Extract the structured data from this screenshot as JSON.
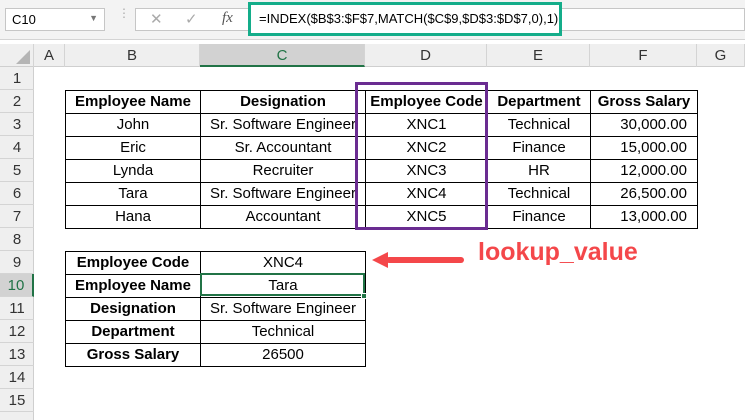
{
  "name_box": "C10",
  "formula": "=INDEX($B$3:$F$7,MATCH($C$9,$D$3:$D$7,0),1)",
  "columns": [
    "A",
    "B",
    "C",
    "D",
    "E",
    "F",
    "G"
  ],
  "rows": [
    "1",
    "2",
    "3",
    "4",
    "5",
    "6",
    "7",
    "8",
    "9",
    "10",
    "11",
    "12",
    "13",
    "14",
    "15"
  ],
  "table": {
    "headers": [
      "Employee Name",
      "Designation",
      "Employee Code",
      "Department",
      "Gross Salary"
    ],
    "rows": [
      [
        "John",
        "Sr. Software Engineer",
        "XNC1",
        "Technical",
        "30,000.00"
      ],
      [
        "Eric",
        "Sr. Accountant",
        "XNC2",
        "Finance",
        "15,000.00"
      ],
      [
        "Lynda",
        "Recruiter",
        "XNC3",
        "HR",
        "12,000.00"
      ],
      [
        "Tara",
        "Sr. Software Engineer",
        "XNC4",
        "Technical",
        "26,500.00"
      ],
      [
        "Hana",
        "Accountant",
        "XNC5",
        "Finance",
        "13,000.00"
      ]
    ]
  },
  "result": [
    {
      "label": "Employee Code",
      "value": "XNC4"
    },
    {
      "label": "Employee Name",
      "value": "Tara"
    },
    {
      "label": "Designation",
      "value": "Sr. Software Engineer"
    },
    {
      "label": "Department",
      "value": "Technical"
    },
    {
      "label": "Gross Salary",
      "value": "26500"
    }
  ],
  "annotation": "lookup_value",
  "colors": {
    "formula_box": "#14ad8a",
    "highlight_box": "#6a2c91",
    "annotation": "#f4474a",
    "selection": "#217346"
  }
}
